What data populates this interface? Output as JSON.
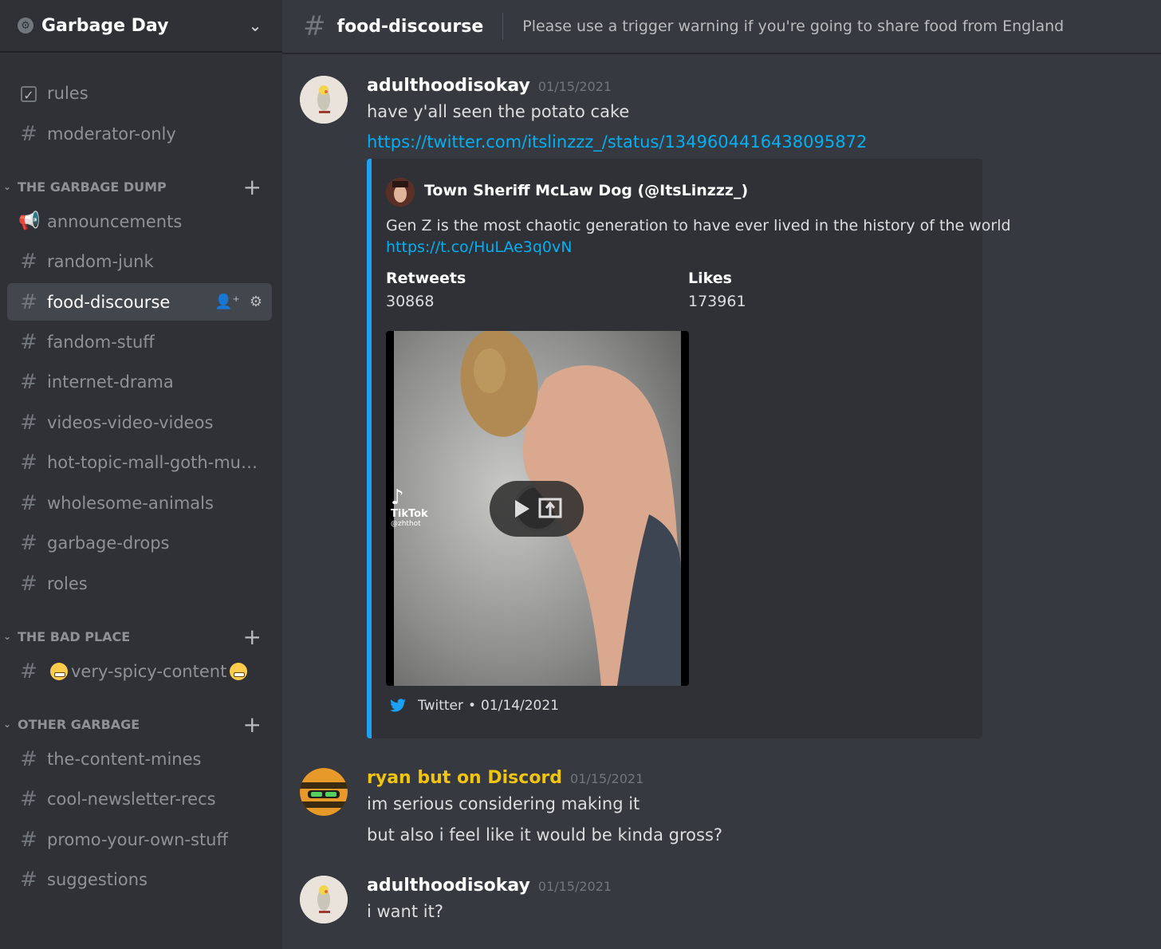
{
  "server": {
    "name": "Garbage Day"
  },
  "sidebar": {
    "top_channels": [
      {
        "label": "rules",
        "icon": "rules-checkbox-icon"
      },
      {
        "label": "moderator-only",
        "icon": "locked-hash-icon"
      }
    ],
    "categories": [
      {
        "name": "THE GARBAGE DUMP",
        "channels": [
          {
            "label": "announcements",
            "icon": "megaphone-icon"
          },
          {
            "label": "random-junk",
            "icon": "hash-icon"
          },
          {
            "label": "food-discourse",
            "icon": "hash-icon",
            "active": true
          },
          {
            "label": "fandom-stuff",
            "icon": "hash-icon"
          },
          {
            "label": "internet-drama",
            "icon": "hash-icon"
          },
          {
            "label": "videos-video-videos",
            "icon": "hash-icon"
          },
          {
            "label": "hot-topic-mall-goth-musi...",
            "icon": "hash-icon"
          },
          {
            "label": "wholesome-animals",
            "icon": "hash-icon"
          },
          {
            "label": "garbage-drops",
            "icon": "hash-icon"
          },
          {
            "label": "roles",
            "icon": "locked-hash-icon"
          }
        ]
      },
      {
        "name": "THE BAD PLACE",
        "channels": [
          {
            "label": "very-spicy-content",
            "icon": "locked-hash-icon"
          }
        ]
      },
      {
        "name": "OTHER GARBAGE",
        "channels": [
          {
            "label": "the-content-mines",
            "icon": "hash-icon"
          },
          {
            "label": "cool-newsletter-recs",
            "icon": "hash-icon"
          },
          {
            "label": "promo-your-own-stuff",
            "icon": "hash-icon"
          },
          {
            "label": "suggestions",
            "icon": "hash-icon"
          }
        ]
      }
    ]
  },
  "header": {
    "channel": "food-discourse",
    "topic": "Please use a trigger warning if you're going to share food from England"
  },
  "messages": [
    {
      "author": "adulthoodisokay",
      "timestamp": "01/15/2021",
      "author_color": "#ffffff",
      "lines": [
        "have y'all seen the potato cake"
      ],
      "link": "https://twitter.com/itslinzzz_/status/1349604416438095872"
    },
    {
      "author": "ryan but on Discord",
      "timestamp": "01/15/2021",
      "author_color": "#f1c40f",
      "lines": [
        "im serious considering making it",
        "but also i feel like it would be kinda gross?"
      ]
    },
    {
      "author": "adulthoodisokay",
      "timestamp": "01/15/2021",
      "author_color": "#ffffff",
      "lines": [
        "i want it?"
      ]
    }
  ],
  "embed": {
    "author": "Town Sheriff McLaw Dog (@ItsLinzzz_)",
    "description": "Gen Z is the most chaotic generation to have ever lived in the history of the world",
    "link": "https://t.co/HuLAe3q0vN",
    "fields": [
      {
        "name": "Retweets",
        "value": "30868"
      },
      {
        "name": "Likes",
        "value": "173961"
      }
    ],
    "video": {
      "watermark": "TikTok",
      "handle": "@zhthot"
    },
    "footer": {
      "source": "Twitter",
      "separator": "•",
      "date": "01/14/2021"
    },
    "accent_color": "#1da1f2"
  },
  "colors": {
    "background": "#36393f",
    "sidebar": "#2f3136",
    "link": "#00b0f4"
  }
}
